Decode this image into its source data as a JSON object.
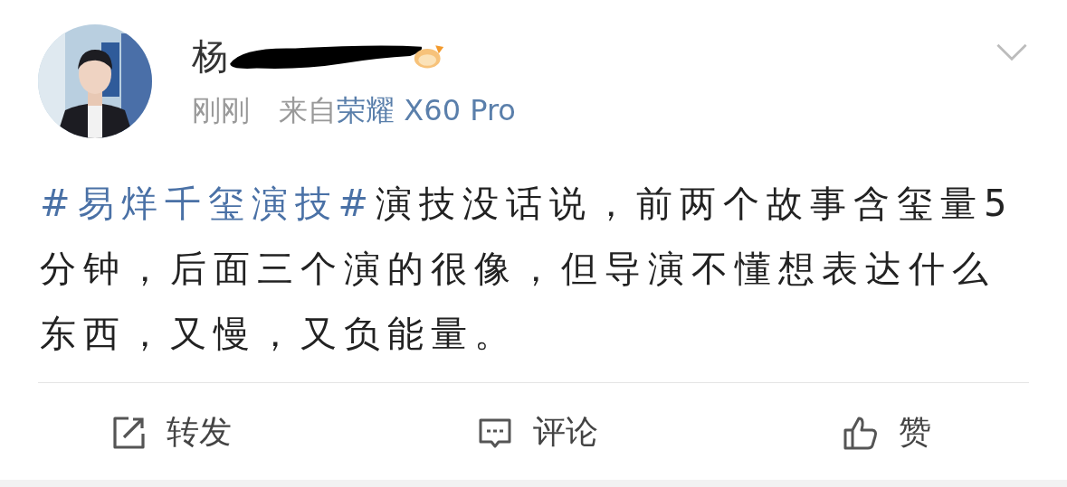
{
  "post": {
    "author": {
      "name": "杨",
      "verified_badge": true
    },
    "time": "刚刚",
    "source_prefix": "来自",
    "source": "荣耀 X60 Pro",
    "hashtag": "#易烊千玺演技#",
    "text": "演技没话说，前两个故事含玺量5分钟，后面三个演的很像，但导演不懂想表达什么东西，又慢，又负能量。"
  },
  "actions": [
    {
      "kind": "repost",
      "label": "转发"
    },
    {
      "kind": "comment",
      "label": "评论"
    },
    {
      "kind": "like",
      "label": "赞"
    }
  ]
}
